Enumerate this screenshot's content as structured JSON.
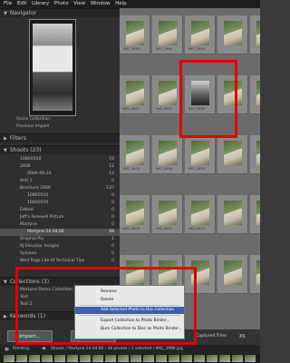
{
  "menubar": [
    "File",
    "Edit",
    "Library",
    "Photo",
    "View",
    "Window",
    "Help"
  ],
  "navigator": {
    "title": "Navigator"
  },
  "nav_rows": [
    "Quick Collection",
    "Previous Import"
  ],
  "filters": {
    "title": "Filters"
  },
  "shoots": {
    "title": "Shoots",
    "count": "(23)"
  },
  "shoot_rows": [
    {
      "label": "10800500",
      "count": "74"
    },
    {
      "label": "2006",
      "count": "12"
    },
    {
      "label": "2006-09-24",
      "count": "12"
    },
    {
      "label": "Anti 1",
      "count": "0"
    },
    {
      "label": "Brochure 2006",
      "count": "137"
    },
    {
      "label": "10800500",
      "count": "0"
    },
    {
      "label": "10800500",
      "count": "0"
    },
    {
      "label": "Edited",
      "count": "0"
    },
    {
      "label": "Jeff's Farewell Picture",
      "count": "0"
    },
    {
      "label": "Martyne",
      "count": "0"
    },
    {
      "label": "Martyne 24.04.06",
      "count": "48"
    },
    {
      "label": "Original Pix",
      "count": "1"
    },
    {
      "label": "RJ Elevator Images",
      "count": "0"
    },
    {
      "label": "Sylvana",
      "count": "0"
    },
    {
      "label": "Wed Page Lite III Technical Tips",
      "count": "0"
    }
  ],
  "collections": {
    "title": "Collections",
    "count": "(3)"
  },
  "collection_rows": [
    {
      "label": "Martyne Demo Collection",
      "count": "0"
    },
    {
      "label": "Test",
      "count": "0"
    },
    {
      "label": "Test 2",
      "count": "0"
    }
  ],
  "keywords": {
    "title": "Keywords",
    "count": "(1)"
  },
  "import_label": "Import...",
  "export_label": "Expo",
  "context_menu": {
    "rename": "Rename",
    "delete": "Delete",
    "add_selected": "Add Selected Photo to this Collection",
    "export_slideshow": "Export Collection to Photo Binder...",
    "burn": "Burn Collection to Disc as Photo Binder..."
  },
  "selected_photo": {
    "label": "IMG_3996",
    "badge": "rate"
  },
  "grid_labels": [
    "IMG_3983",
    "IMG_3990",
    "IMG_3994",
    "IMG_3996",
    "IMG_4001",
    "IMG_4002",
    "IMG_4003",
    "IMG_4004",
    "IMG_4005",
    "IMG_4006",
    "IMG_4010",
    "IMG_4014",
    "IMG_4020"
  ],
  "filmstrip": {
    "label": "Filmstrip",
    "path": "Shoots / Martyne 24.04.06 / 48 photos / 1 selected / IMG_3996.jpg"
  },
  "sort": {
    "label": "Captured Time",
    "xs": "XS"
  }
}
